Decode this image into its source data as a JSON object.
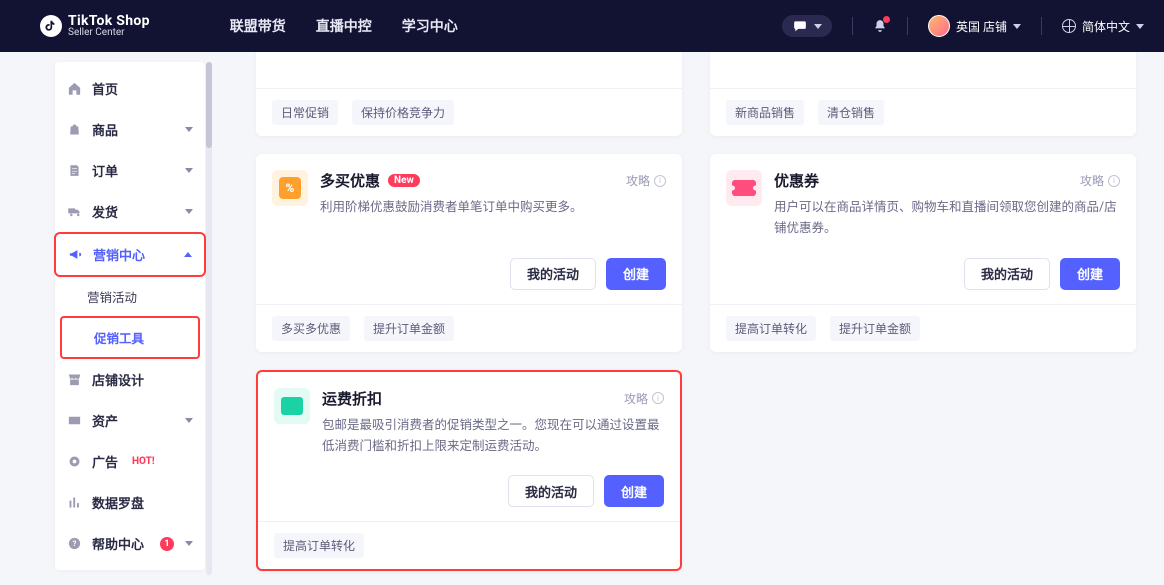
{
  "header": {
    "brand_top": "TikTok Shop",
    "brand_bottom": "Seller Center",
    "nav": [
      "联盟带货",
      "直播中控",
      "学习中心"
    ],
    "store_label": "英国 店铺",
    "lang_label": "简体中文"
  },
  "sidebar": {
    "home": "首页",
    "products": "商品",
    "orders": "订单",
    "shipping": "发货",
    "marketing": "营销中心",
    "marketing_sub": {
      "activities": "营销活动",
      "promo_tools": "促销工具"
    },
    "store_design": "店铺设计",
    "assets": "资产",
    "ads": "广告",
    "ads_hot": "HOT!",
    "data": "数据罗盘",
    "help": "帮助中心",
    "help_badge": "1"
  },
  "cards": {
    "stub_left_tags": [
      "日常促销",
      "保持价格竞争力"
    ],
    "stub_right_tags": [
      "新商品销售",
      "清仓销售"
    ],
    "multi_buy": {
      "title": "多买优惠",
      "new": "New",
      "desc": "利用阶梯优惠鼓励消费者单笔订单中购买更多。",
      "tags": [
        "多买多优惠",
        "提升订单金额"
      ]
    },
    "coupon": {
      "title": "优惠券",
      "desc": "用户可以在商品详情页、购物车和直播间领取您创建的商品/店铺优惠券。",
      "tags": [
        "提高订单转化",
        "提升订单金额"
      ]
    },
    "shipping": {
      "title": "运费折扣",
      "desc": "包邮是最吸引消费者的促销类型之一。您现在可以通过设置最低消费门槛和折扣上限来定制运费活动。",
      "tags": [
        "提高订单转化"
      ]
    },
    "strategy_label": "攻略",
    "my_activity": "我的活动",
    "create": "创建"
  }
}
